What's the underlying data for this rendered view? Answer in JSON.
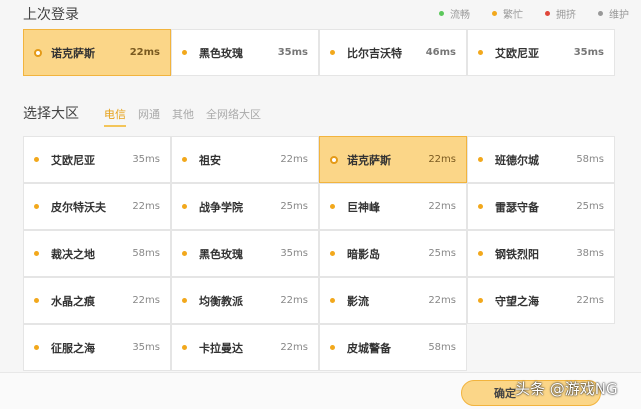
{
  "recent": {
    "title": "上次登录",
    "servers": [
      {
        "name": "诺克萨斯",
        "ping": "22ms",
        "selected": true
      },
      {
        "name": "黑色玫瑰",
        "ping": "35ms"
      },
      {
        "name": "比尔吉沃特",
        "ping": "46ms"
      },
      {
        "name": "艾欧尼亚",
        "ping": "35ms"
      }
    ]
  },
  "legend": [
    {
      "label": "流畅",
      "color": "#5cc85c"
    },
    {
      "label": "繁忙",
      "color": "#f2a81c"
    },
    {
      "label": "拥挤",
      "color": "#e0473a"
    },
    {
      "label": "维护",
      "color": "#999999"
    }
  ],
  "region": {
    "title": "选择大区",
    "tabs": [
      {
        "label": "电信",
        "active": true
      },
      {
        "label": "网通"
      },
      {
        "label": "其他"
      },
      {
        "label": "全网络大区"
      }
    ],
    "servers": [
      {
        "name": "艾欧尼亚",
        "ping": "35ms"
      },
      {
        "name": "祖安",
        "ping": "22ms"
      },
      {
        "name": "诺克萨斯",
        "ping": "22ms",
        "selected": true
      },
      {
        "name": "班德尔城",
        "ping": "58ms"
      },
      {
        "name": "皮尔特沃夫",
        "ping": "22ms"
      },
      {
        "name": "战争学院",
        "ping": "25ms"
      },
      {
        "name": "巨神峰",
        "ping": "22ms"
      },
      {
        "name": "雷瑟守备",
        "ping": "25ms"
      },
      {
        "name": "裁决之地",
        "ping": "58ms"
      },
      {
        "name": "黑色玫瑰",
        "ping": "35ms"
      },
      {
        "name": "暗影岛",
        "ping": "25ms"
      },
      {
        "name": "钢铁烈阳",
        "ping": "38ms"
      },
      {
        "name": "水晶之痕",
        "ping": "22ms"
      },
      {
        "name": "均衡教派",
        "ping": "22ms"
      },
      {
        "name": "影流",
        "ping": "22ms"
      },
      {
        "name": "守望之海",
        "ping": "22ms"
      },
      {
        "name": "征服之海",
        "ping": "35ms"
      },
      {
        "name": "卡拉曼达",
        "ping": "22ms"
      },
      {
        "name": "皮城警备",
        "ping": "58ms"
      }
    ]
  },
  "footer": {
    "confirm_label": "确定",
    "watermark": "头条 @游戏NG"
  }
}
